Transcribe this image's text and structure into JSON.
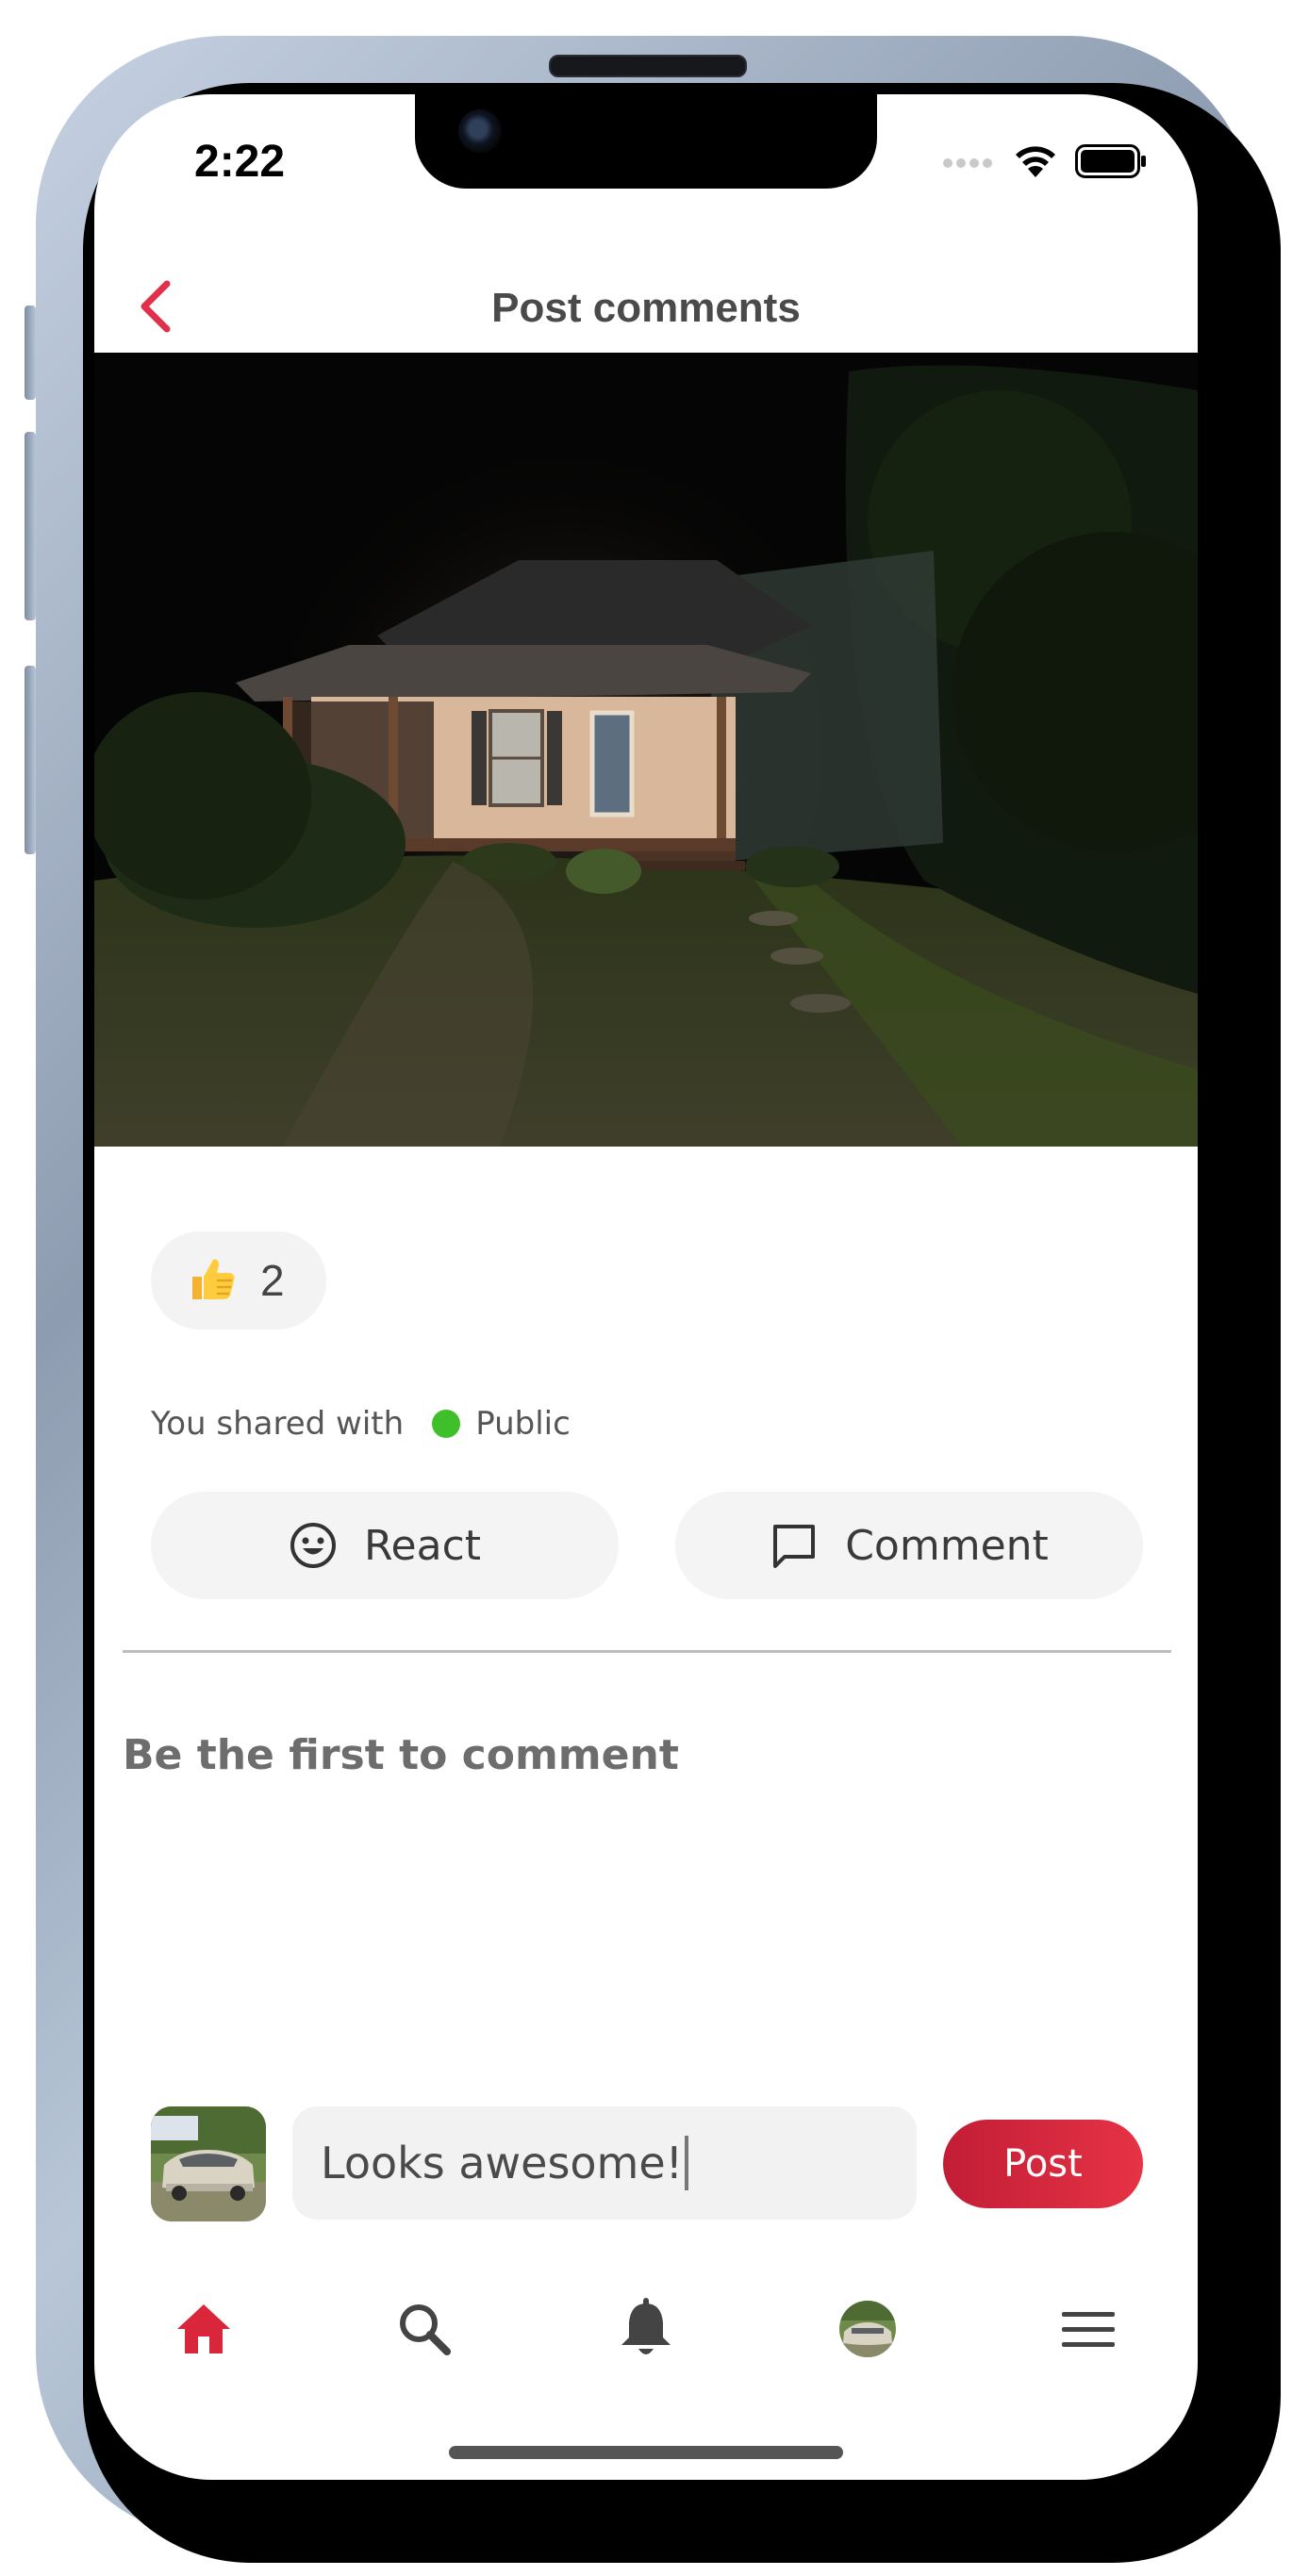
{
  "status_bar": {
    "time": "2:22"
  },
  "header": {
    "title": "Post comments",
    "back_icon": "chevron-left-icon"
  },
  "post": {
    "image_alt": "house-at-night-photo",
    "reactions": {
      "emoji": "thumbs-up-icon",
      "count": "2"
    },
    "shared": {
      "prefix": "You shared with",
      "audience": "Public",
      "audience_color": "#3fbf2a"
    },
    "actions": {
      "react_label": "React",
      "comment_label": "Comment"
    }
  },
  "comments": {
    "empty_text": "Be the first to comment"
  },
  "composer": {
    "input_value": "Looks awesome!",
    "post_label": "Post"
  },
  "bottom_nav": {
    "items": [
      {
        "name": "home",
        "icon": "home-icon",
        "active": true
      },
      {
        "name": "search",
        "icon": "search-icon",
        "active": false
      },
      {
        "name": "notifications",
        "icon": "bell-icon",
        "active": false
      },
      {
        "name": "profile",
        "icon": "avatar",
        "active": false
      },
      {
        "name": "menu",
        "icon": "hamburger-menu-icon",
        "active": false
      }
    ]
  },
  "colors": {
    "accent": "#d9263b",
    "chip_bg": "#f3f3f3",
    "text_muted": "#6d6d6d"
  }
}
